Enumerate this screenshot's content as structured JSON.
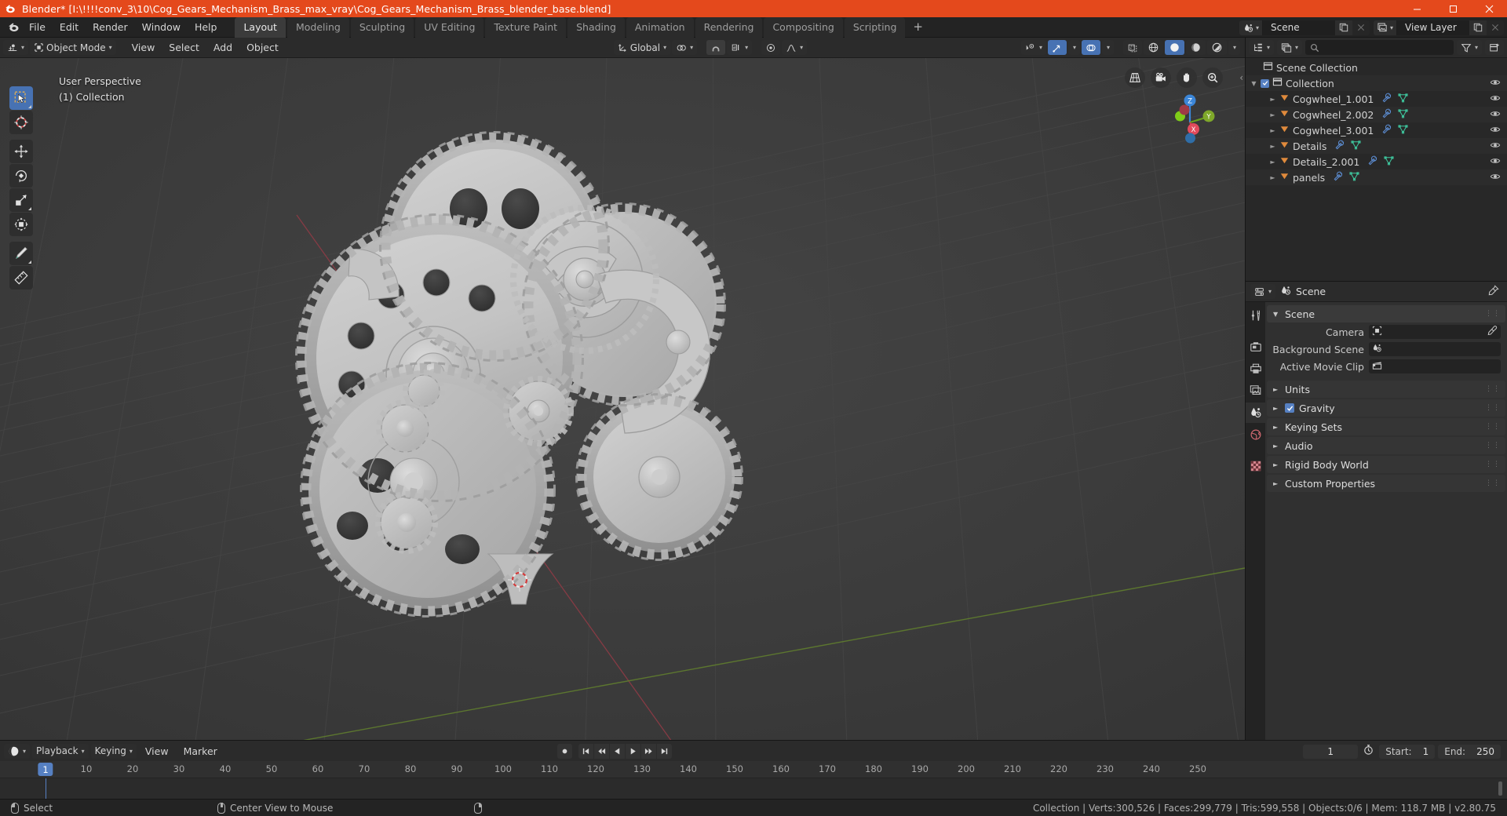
{
  "window": {
    "title": "Blender* [I:\\!!!!conv_3\\10\\Cog_Gears_Mechanism_Brass_max_vray\\Cog_Gears_Mechanism_Brass_blender_base.blend]",
    "accent_color": "#e4491c",
    "controls": {
      "minimize": "minimize-icon",
      "maximize": "maximize-icon",
      "close": "close-icon"
    }
  },
  "topbar": {
    "menus": [
      "File",
      "Edit",
      "Render",
      "Window",
      "Help"
    ],
    "workspaces": [
      {
        "label": "Layout",
        "active": true
      },
      {
        "label": "Modeling",
        "active": false
      },
      {
        "label": "Sculpting",
        "active": false
      },
      {
        "label": "UV Editing",
        "active": false
      },
      {
        "label": "Texture Paint",
        "active": false
      },
      {
        "label": "Shading",
        "active": false
      },
      {
        "label": "Animation",
        "active": false
      },
      {
        "label": "Rendering",
        "active": false
      },
      {
        "label": "Compositing",
        "active": false
      },
      {
        "label": "Scripting",
        "active": false
      }
    ],
    "add_workspace": "+",
    "scene_name": "Scene",
    "view_layer_name": "View Layer"
  },
  "viewport": {
    "header": {
      "mode": "Object Mode",
      "menus": [
        "View",
        "Select",
        "Add",
        "Object"
      ],
      "transform_orientation": "Global"
    },
    "overlay": {
      "perspective": "User Perspective",
      "collection": "(1) Collection"
    },
    "gizmo": {
      "z": "Z",
      "y": "Y",
      "x": "X"
    },
    "tools": [
      "tweak-select-box-tool",
      "cursor-tool",
      "move-tool",
      "rotate-tool",
      "scale-tool",
      "transform-tool",
      "annotate-tool",
      "measure-tool"
    ],
    "nav_icons": [
      "grid-perspective-icon",
      "camera-view-icon",
      "hand-pan-icon",
      "zoom-magnifier-icon"
    ],
    "shading_modes": [
      "wireframe-shading-icon",
      "solid-shading-icon",
      "material-preview-icon",
      "rendered-shading-icon"
    ],
    "active_shading": "solid-shading-icon"
  },
  "outliner": {
    "search_placeholder": "",
    "rows": [
      {
        "label": "Scene Collection",
        "indent": 0,
        "icon": "collection-icon",
        "disclosure": "",
        "checkbox": false,
        "eye": false,
        "modifiers": []
      },
      {
        "label": "Collection",
        "indent": 1,
        "icon": "collection-icon",
        "disclosure": "down",
        "checkbox": true,
        "eye": true,
        "modifiers": []
      },
      {
        "label": "Cogwheel_1.001",
        "indent": 2,
        "icon": "mesh-object-icon",
        "disclosure": "right",
        "checkbox": false,
        "eye": true,
        "modifiers": [
          "wrench-icon",
          "mesh-data-icon"
        ]
      },
      {
        "label": "Cogwheel_2.002",
        "indent": 2,
        "icon": "mesh-object-icon",
        "disclosure": "right",
        "checkbox": false,
        "eye": true,
        "modifiers": [
          "wrench-icon",
          "mesh-data-icon"
        ]
      },
      {
        "label": "Cogwheel_3.001",
        "indent": 2,
        "icon": "mesh-object-icon",
        "disclosure": "right",
        "checkbox": false,
        "eye": true,
        "modifiers": [
          "wrench-icon",
          "mesh-data-icon"
        ]
      },
      {
        "label": "Details",
        "indent": 2,
        "icon": "mesh-object-icon",
        "disclosure": "right",
        "checkbox": false,
        "eye": true,
        "modifiers": [
          "wrench-icon",
          "mesh-data-icon"
        ]
      },
      {
        "label": "Details_2.001",
        "indent": 2,
        "icon": "mesh-object-icon",
        "disclosure": "right",
        "checkbox": false,
        "eye": true,
        "modifiers": [
          "wrench-icon",
          "mesh-data-icon"
        ]
      },
      {
        "label": "panels",
        "indent": 2,
        "icon": "mesh-object-icon",
        "disclosure": "right",
        "checkbox": false,
        "eye": true,
        "modifiers": [
          "wrench-icon",
          "mesh-data-icon"
        ]
      }
    ]
  },
  "properties": {
    "breadcrumb": "Scene",
    "tabs": [
      {
        "name": "tool-properties-tab",
        "active": false
      },
      {
        "name": "render-properties-tab",
        "active": false
      },
      {
        "name": "output-properties-tab",
        "active": false
      },
      {
        "name": "view-layer-properties-tab",
        "active": false
      },
      {
        "name": "scene-properties-tab",
        "active": true
      },
      {
        "name": "world-properties-tab",
        "active": false
      },
      {
        "name": "texture-properties-tab",
        "active": false
      }
    ],
    "panel_title": "Scene",
    "fields": [
      {
        "label": "Camera",
        "value": "",
        "icon": "camera-data-icon",
        "picker": true
      },
      {
        "label": "Background Scene",
        "value": "",
        "icon": "scene-icon",
        "picker": false
      },
      {
        "label": "Active Movie Clip",
        "value": "",
        "icon": "movie-clip-icon",
        "picker": false
      }
    ],
    "sections": [
      {
        "label": "Units",
        "checkbox": false,
        "expanded": false
      },
      {
        "label": "Gravity",
        "checkbox": true,
        "expanded": false
      },
      {
        "label": "Keying Sets",
        "checkbox": false,
        "expanded": false
      },
      {
        "label": "Audio",
        "checkbox": false,
        "expanded": false
      },
      {
        "label": "Rigid Body World",
        "checkbox": false,
        "expanded": false
      },
      {
        "label": "Custom Properties",
        "checkbox": false,
        "expanded": false
      }
    ]
  },
  "timeline": {
    "menus": [
      "Playback",
      "Keying",
      "View",
      "Marker"
    ],
    "playback_buttons": [
      "record-icon",
      "jump-start-icon",
      "prev-keyframe-icon",
      "play-reverse-icon",
      "play-icon",
      "next-keyframe-icon",
      "jump-end-icon"
    ],
    "current_frame": "1",
    "start_label": "Start:",
    "start_value": "1",
    "end_label": "End:",
    "end_value": "250",
    "ruler_ticks": [
      "1",
      "10",
      "20",
      "30",
      "40",
      "50",
      "60",
      "70",
      "80",
      "90",
      "100",
      "110",
      "120",
      "130",
      "140",
      "150",
      "160",
      "170",
      "180",
      "190",
      "200",
      "210",
      "220",
      "230",
      "240",
      "250"
    ],
    "playhead_frame": "1",
    "playhead_color": "#5680c2"
  },
  "statusbar": {
    "left_items": [
      {
        "mouse": "left-mouse-icon",
        "label": "Select"
      },
      {
        "mouse": "middle-mouse-icon",
        "label": "Center View to Mouse"
      },
      {
        "mouse": "right-mouse-icon",
        "label": ""
      }
    ],
    "stats": "Collection | Verts:300,526 | Faces:299,779 | Tris:599,558 | Objects:0/6 | Mem: 118.7 MB | v2.80.75"
  }
}
